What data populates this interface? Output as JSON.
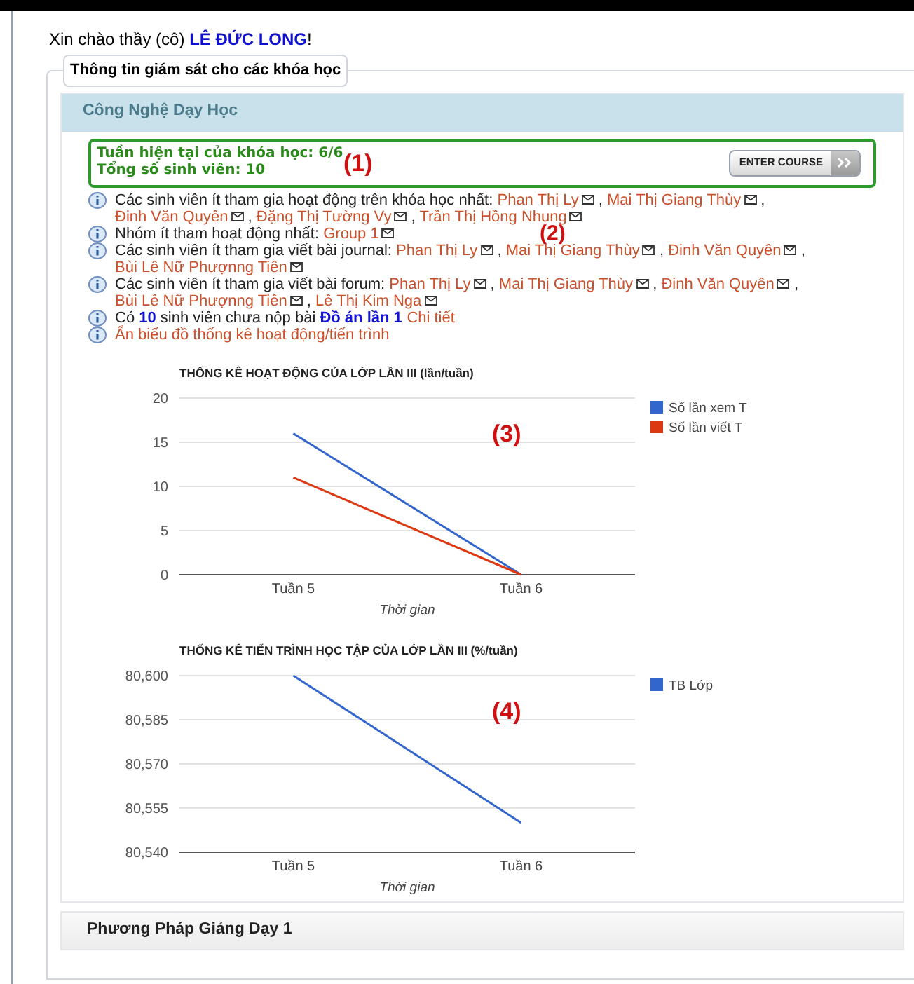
{
  "greeting": {
    "text": "Xin chào thầy (cô)",
    "teacher": "LÊ ĐỨC LONG",
    "suffix": "!"
  },
  "section": {
    "legend": "Thông tin giám sát cho các khóa học",
    "course": {
      "title": "Công Nghệ Dạy Học",
      "summary": {
        "lines": [
          "Tuần hiện tại của khóa học: 6/6",
          "Tổng số sinh viên: 10"
        ],
        "callout": "(1)",
        "button": "ENTER COURSE"
      },
      "info_callout": "(2)",
      "info": [
        {
          "segments": [
            {
              "kind": "text",
              "text": "Các sinh viên ít tham gia hoạt động trên khóa học nhất: "
            },
            {
              "kind": "link",
              "text": "Phan Thị Ly",
              "mail": true
            },
            {
              "kind": "text",
              "text": " , "
            },
            {
              "kind": "link",
              "text": "Mai Thị Giang Thùy",
              "mail": true
            },
            {
              "kind": "text",
              "text": " , "
            },
            {
              "kind": "link",
              "text": "Đinh Văn Quyên",
              "mail": true
            },
            {
              "kind": "text",
              "text": " , "
            },
            {
              "kind": "link",
              "text": "Đặng Thị Tường Vy",
              "mail": true
            },
            {
              "kind": "text",
              "text": " , "
            },
            {
              "kind": "link",
              "text": "Trần Thị Hồng Nhung",
              "mail": true
            }
          ]
        },
        {
          "segments": [
            {
              "kind": "text",
              "text": "Nhóm ít tham hoạt động nhất: "
            },
            {
              "kind": "link",
              "text": "Group 1",
              "mail": true
            }
          ]
        },
        {
          "segments": [
            {
              "kind": "text",
              "text": "Các sinh viên ít tham gia viết bài journal: "
            },
            {
              "kind": "link",
              "text": "Phan Thị Ly",
              "mail": true
            },
            {
              "kind": "text",
              "text": " , "
            },
            {
              "kind": "link",
              "text": "Mai Thị Giang Thùy",
              "mail": true
            },
            {
              "kind": "text",
              "text": " , "
            },
            {
              "kind": "link",
              "text": "Đinh Văn Quyên",
              "mail": true
            },
            {
              "kind": "text",
              "text": " , "
            },
            {
              "kind": "link",
              "text": "Bùi Lê Nữ Phượnng Tiên",
              "mail": true
            }
          ]
        },
        {
          "segments": [
            {
              "kind": "text",
              "text": "Các sinh viên ít tham gia viết bài forum: "
            },
            {
              "kind": "link",
              "text": "Phan Thị Ly",
              "mail": true
            },
            {
              "kind": "text",
              "text": " , "
            },
            {
              "kind": "link",
              "text": "Mai Thị Giang Thùy",
              "mail": true
            },
            {
              "kind": "text",
              "text": " , "
            },
            {
              "kind": "link",
              "text": "Đinh Văn Quyên",
              "mail": true
            },
            {
              "kind": "text",
              "text": " , "
            },
            {
              "kind": "link",
              "text": "Bùi Lê Nữ Phượnng Tiên",
              "mail": true
            },
            {
              "kind": "text",
              "text": " , "
            },
            {
              "kind": "link",
              "text": "Lê Thị Kim Nga",
              "mail": true
            }
          ]
        },
        {
          "segments": [
            {
              "kind": "text",
              "text": "Có "
            },
            {
              "kind": "strong",
              "text": "10"
            },
            {
              "kind": "text",
              "text": " sinh viên chưa nộp bài "
            },
            {
              "kind": "strong",
              "text": "Đồ án lần 1"
            },
            {
              "kind": "link",
              "text": "Chi tiết",
              "mail": false
            }
          ]
        },
        {
          "segments": [
            {
              "kind": "link",
              "text": "Ẩn biểu đồ thống kê hoạt động/tiến trình",
              "mail": false
            }
          ]
        }
      ],
      "charts": [
        {
          "chart_data": {
            "type": "line",
            "title": "THỐNG KÊ HOẠT ĐỘNG CỦA LỚP LẦN III (lần/tuần)",
            "xlabel": "Thời gian",
            "categories": [
              "Tuần 5",
              "Tuần 6"
            ],
            "series": [
              {
                "name": "Số lần xem T",
                "color": "#3366cc",
                "values": [
                  16,
                  0
                ]
              },
              {
                "name": "Số lần viết T",
                "color": "#dc3912",
                "values": [
                  11,
                  0
                ]
              }
            ],
            "ylim": [
              0,
              20
            ],
            "yticks": [
              0,
              5,
              10,
              15,
              20
            ],
            "grid": true,
            "legend": true,
            "annotations": [
              {
                "text": "(3)"
              }
            ]
          }
        },
        {
          "chart_data": {
            "type": "line",
            "title": "THỐNG KÊ TIẾN TRÌNH HỌC TẬP CỦA LỚP LẦN III (%/tuần)",
            "xlabel": "Thời gian",
            "categories": [
              "Tuần 5",
              "Tuần 6"
            ],
            "series": [
              {
                "name": "TB Lớp",
                "color": "#3366cc",
                "values": [
                  80600,
                  80550
                ]
              }
            ],
            "ylim": [
              80540,
              80600
            ],
            "grid": true,
            "legend": true,
            "yticks": [
              {
                "value": 80540,
                "label": "80,540"
              },
              {
                "value": 80555,
                "label": "80,555"
              },
              {
                "value": 80570,
                "label": "80,570"
              },
              {
                "value": 80585,
                "label": "80,585"
              },
              {
                "value": 80600,
                "label": "80,600"
              }
            ],
            "annotations": [
              {
                "text": "(4)"
              }
            ]
          }
        }
      ]
    },
    "next_course": {
      "title": "Phương Pháp Giảng Dạy 1"
    }
  }
}
